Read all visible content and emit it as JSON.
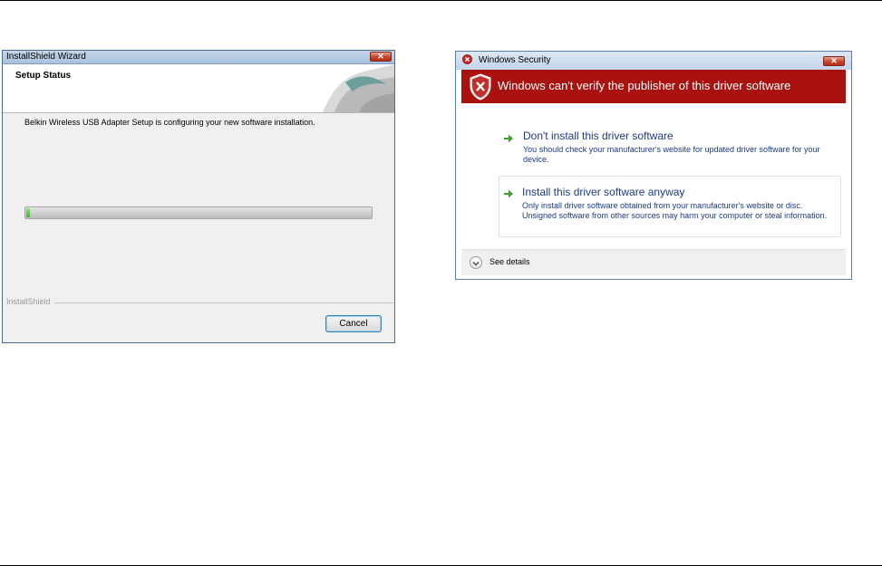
{
  "installshield": {
    "title": "InstallShield Wizard",
    "close_glyph": "✕",
    "header_title": "Setup Status",
    "status_text": "Belkin Wireless USB Adapter Setup is configuring your new software installation.",
    "progress_fraction": 0.01,
    "brand": "InstallShield",
    "cancel_label": "Cancel"
  },
  "windows_security": {
    "title": "Windows Security",
    "close_glyph": "✕",
    "banner_text": "Windows can't verify the publisher of this driver software",
    "banner_color": "#aa1210",
    "options": [
      {
        "title": "Don't install this driver software",
        "description": "You should check your manufacturer's website for updated driver software for your device.",
        "icon": "green-arrow-icon"
      },
      {
        "title": "Install this driver software anyway",
        "description": "Only install driver software obtained from your manufacturer's website or disc. Unsigned software from other sources may harm your computer or steal information.",
        "icon": "green-arrow-icon"
      }
    ],
    "details_label": "See details"
  }
}
